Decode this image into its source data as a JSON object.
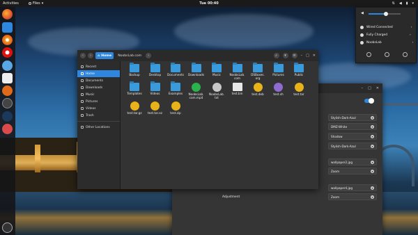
{
  "topbar": {
    "activities": "Activities",
    "app_name": "Files",
    "clock": "Tue 00:40"
  },
  "dock": {
    "items": [
      "firefox-icon",
      "files-icon",
      "rhythmbox-icon",
      "redirect-icon",
      "libreoffice-icon",
      "software-center-icon",
      "settings-icon",
      "terminal-icon",
      "usb-icon"
    ],
    "apps_grid_icon": "grid-icon"
  },
  "menu": {
    "items": [
      "Wired Connected",
      "Fully Charged",
      "NoobsLab"
    ],
    "volume": 0.55
  },
  "settings_window": {
    "rows": [
      "Stylish-Dark-Azul",
      "DMZ-White",
      "Shadow",
      "Stylish-Dark-Azul",
      "wallpaper2.jpg",
      "Zoom",
      "wallpaper4.jpg",
      "Zoom"
    ],
    "adjustment_label": "Adjustment"
  },
  "files": {
    "breadcrumb_home": "Home",
    "breadcrumb_next": "NoobsLab.com",
    "sidebar": [
      "Recent",
      "Home",
      "Documents",
      "Downloads",
      "Music",
      "Pictures",
      "Videos",
      "Trash"
    ],
    "other_locations": "Other Locations",
    "items": [
      {
        "name": "Backup",
        "kind": "folder"
      },
      {
        "name": "Desktop",
        "kind": "folder"
      },
      {
        "name": "Documents",
        "kind": "folder"
      },
      {
        "name": "Downloads",
        "kind": "folder"
      },
      {
        "name": "Music",
        "kind": "folder"
      },
      {
        "name": "NoobsLab.\ncom",
        "kind": "folder"
      },
      {
        "name": "DSBoxes.\norg",
        "kind": "folder"
      },
      {
        "name": "Pictures",
        "kind": "folder"
      },
      {
        "name": "Public",
        "kind": "folder"
      },
      {
        "name": "Templates",
        "kind": "folder"
      },
      {
        "name": "Videos",
        "kind": "folder"
      },
      {
        "name": "Examples",
        "kind": "folder"
      },
      {
        "name": "NoobsLab.\ncom.mp4",
        "kind": "video"
      },
      {
        "name": "NoobsLab.\ntxt",
        "kind": "txt"
      },
      {
        "name": "test.bin",
        "kind": "doc"
      },
      {
        "name": "test.deb",
        "kind": "pkg"
      },
      {
        "name": "test.sh",
        "kind": "purp"
      },
      {
        "name": "test.tar",
        "kind": "pkg"
      },
      {
        "name": "test.tar.gz",
        "kind": "pkg"
      },
      {
        "name": "test.tar.xz",
        "kind": "pkg"
      },
      {
        "name": "test.zip",
        "kind": "pkg"
      }
    ]
  }
}
